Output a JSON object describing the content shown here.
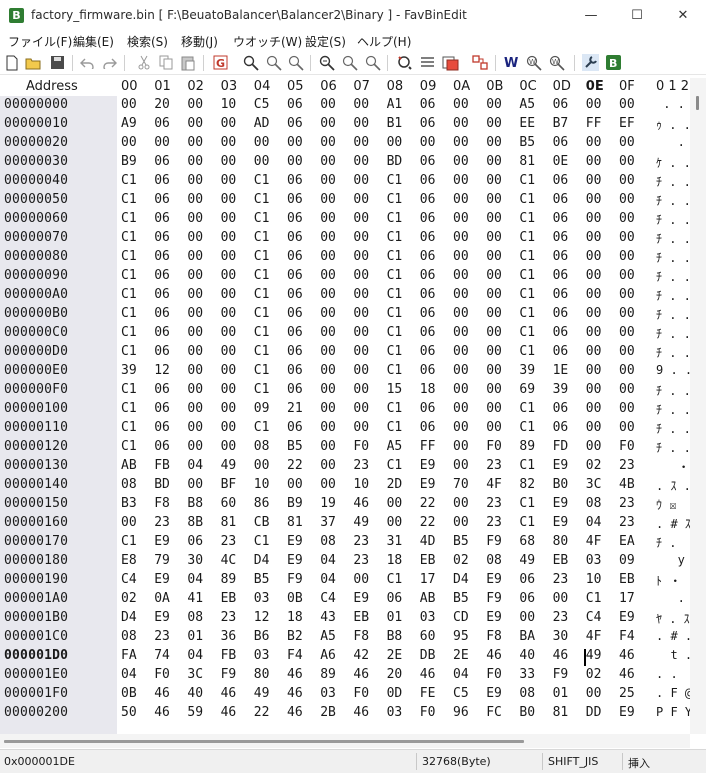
{
  "window": {
    "title": "factory_firmware.bin [ F:\\BeuatoBalancer\\Balancer2\\Binary ] - FavBinEdit",
    "app_icon_letter": "B",
    "minimize": "—",
    "maximize": "☐",
    "close": "✕"
  },
  "menu": [
    "ファイル(F)",
    "編集(E)",
    "検索(S)",
    "移動(J)",
    "ウオッチ(W)",
    "設定(S)",
    "ヘルプ(H)"
  ],
  "toolbar": {
    "icons": [
      "new-file-icon",
      "open-folder-icon",
      "save-icon",
      "undo-icon",
      "redo-icon",
      "cut-icon",
      "copy-icon",
      "paste-icon",
      "goto-icon",
      "search-icon",
      "search-next-icon",
      "search-prev-icon",
      "find-all-icon",
      "find-next-icon",
      "find-prev-icon",
      "compare-icon",
      "list-icon",
      "bookmark-icon",
      "jump-icon",
      "watch-icon",
      "watch-search-icon",
      "watch-settings-icon",
      "settings-wrench-icon",
      "about-icon"
    ]
  },
  "hex": {
    "address_header": "Address",
    "column_headers": [
      "00",
      "01",
      "02",
      "03",
      "04",
      "05",
      "06",
      "07",
      "08",
      "09",
      "0A",
      "0B",
      "0C",
      "0D",
      "0E",
      "0F"
    ],
    "active_column": "0E",
    "text_header": "0 1 2",
    "active_address": "000001D0",
    "rows": [
      {
        "addr": "00000000",
        "bytes": [
          "00",
          "20",
          "00",
          "10",
          "C5",
          "06",
          "00",
          "00",
          "A1",
          "06",
          "00",
          "00",
          "A5",
          "06",
          "00",
          "00"
        ],
        "text": " . ."
      },
      {
        "addr": "00000010",
        "bytes": [
          "A9",
          "06",
          "00",
          "00",
          "AD",
          "06",
          "00",
          "00",
          "B1",
          "06",
          "00",
          "00",
          "EE",
          "B7",
          "FF",
          "EF"
        ],
        "text": "ｩ . ."
      },
      {
        "addr": "00000020",
        "bytes": [
          "00",
          "00",
          "00",
          "00",
          "00",
          "00",
          "00",
          "00",
          "00",
          "00",
          "00",
          "00",
          "B5",
          "06",
          "00",
          "00"
        ],
        "text": "   . ."
      },
      {
        "addr": "00000030",
        "bytes": [
          "B9",
          "06",
          "00",
          "00",
          "00",
          "00",
          "00",
          "00",
          "BD",
          "06",
          "00",
          "00",
          "81",
          "0E",
          "00",
          "00"
        ],
        "text": "ｹ . ."
      },
      {
        "addr": "00000040",
        "bytes": [
          "C1",
          "06",
          "00",
          "00",
          "C1",
          "06",
          "00",
          "00",
          "C1",
          "06",
          "00",
          "00",
          "C1",
          "06",
          "00",
          "00"
        ],
        "text": "ﾁ . ."
      },
      {
        "addr": "00000050",
        "bytes": [
          "C1",
          "06",
          "00",
          "00",
          "C1",
          "06",
          "00",
          "00",
          "C1",
          "06",
          "00",
          "00",
          "C1",
          "06",
          "00",
          "00"
        ],
        "text": "ﾁ . ."
      },
      {
        "addr": "00000060",
        "bytes": [
          "C1",
          "06",
          "00",
          "00",
          "C1",
          "06",
          "00",
          "00",
          "C1",
          "06",
          "00",
          "00",
          "C1",
          "06",
          "00",
          "00"
        ],
        "text": "ﾁ . ."
      },
      {
        "addr": "00000070",
        "bytes": [
          "C1",
          "06",
          "00",
          "00",
          "C1",
          "06",
          "00",
          "00",
          "C1",
          "06",
          "00",
          "00",
          "C1",
          "06",
          "00",
          "00"
        ],
        "text": "ﾁ . ."
      },
      {
        "addr": "00000080",
        "bytes": [
          "C1",
          "06",
          "00",
          "00",
          "C1",
          "06",
          "00",
          "00",
          "C1",
          "06",
          "00",
          "00",
          "C1",
          "06",
          "00",
          "00"
        ],
        "text": "ﾁ . ."
      },
      {
        "addr": "00000090",
        "bytes": [
          "C1",
          "06",
          "00",
          "00",
          "C1",
          "06",
          "00",
          "00",
          "C1",
          "06",
          "00",
          "00",
          "C1",
          "06",
          "00",
          "00"
        ],
        "text": "ﾁ . ."
      },
      {
        "addr": "000000A0",
        "bytes": [
          "C1",
          "06",
          "00",
          "00",
          "C1",
          "06",
          "00",
          "00",
          "C1",
          "06",
          "00",
          "00",
          "C1",
          "06",
          "00",
          "00"
        ],
        "text": "ﾁ . ."
      },
      {
        "addr": "000000B0",
        "bytes": [
          "C1",
          "06",
          "00",
          "00",
          "C1",
          "06",
          "00",
          "00",
          "C1",
          "06",
          "00",
          "00",
          "C1",
          "06",
          "00",
          "00"
        ],
        "text": "ﾁ . ."
      },
      {
        "addr": "000000C0",
        "bytes": [
          "C1",
          "06",
          "00",
          "00",
          "C1",
          "06",
          "00",
          "00",
          "C1",
          "06",
          "00",
          "00",
          "C1",
          "06",
          "00",
          "00"
        ],
        "text": "ﾁ . ."
      },
      {
        "addr": "000000D0",
        "bytes": [
          "C1",
          "06",
          "00",
          "00",
          "C1",
          "06",
          "00",
          "00",
          "C1",
          "06",
          "00",
          "00",
          "C1",
          "06",
          "00",
          "00"
        ],
        "text": "ﾁ . ."
      },
      {
        "addr": "000000E0",
        "bytes": [
          "39",
          "12",
          "00",
          "00",
          "C1",
          "06",
          "00",
          "00",
          "C1",
          "06",
          "00",
          "00",
          "39",
          "1E",
          "00",
          "00"
        ],
        "text": "9 . ."
      },
      {
        "addr": "000000F0",
        "bytes": [
          "C1",
          "06",
          "00",
          "00",
          "C1",
          "06",
          "00",
          "00",
          "15",
          "18",
          "00",
          "00",
          "69",
          "39",
          "00",
          "00"
        ],
        "text": "ﾁ . ."
      },
      {
        "addr": "00000100",
        "bytes": [
          "C1",
          "06",
          "00",
          "00",
          "09",
          "21",
          "00",
          "00",
          "C1",
          "06",
          "00",
          "00",
          "C1",
          "06",
          "00",
          "00"
        ],
        "text": "ﾁ . ."
      },
      {
        "addr": "00000110",
        "bytes": [
          "C1",
          "06",
          "00",
          "00",
          "C1",
          "06",
          "00",
          "00",
          "C1",
          "06",
          "00",
          "00",
          "C1",
          "06",
          "00",
          "00"
        ],
        "text": "ﾁ . ."
      },
      {
        "addr": "00000120",
        "bytes": [
          "C1",
          "06",
          "00",
          "00",
          "08",
          "B5",
          "00",
          "F0",
          "A5",
          "FF",
          "00",
          "F0",
          "89",
          "FD",
          "00",
          "F0"
        ],
        "text": "ﾁ . ."
      },
      {
        "addr": "00000130",
        "bytes": [
          "AB",
          "FB",
          "04",
          "49",
          "00",
          "22",
          "00",
          "23",
          "C1",
          "E9",
          "00",
          "23",
          "C1",
          "E9",
          "02",
          "23"
        ],
        "text": "   ・"
      },
      {
        "addr": "00000140",
        "bytes": [
          "08",
          "BD",
          "00",
          "BF",
          "10",
          "00",
          "00",
          "10",
          "2D",
          "E9",
          "70",
          "4F",
          "82",
          "B0",
          "3C",
          "4B"
        ],
        "text": ". ｽ ."
      },
      {
        "addr": "00000150",
        "bytes": [
          "B3",
          "F8",
          "B8",
          "60",
          "86",
          "B9",
          "19",
          "46",
          "00",
          "22",
          "00",
          "23",
          "C1",
          "E9",
          "08",
          "23"
        ],
        "text": "ｳ ☒"
      },
      {
        "addr": "00000160",
        "bytes": [
          "00",
          "23",
          "8B",
          "81",
          "CB",
          "81",
          "37",
          "49",
          "00",
          "22",
          "00",
          "23",
          "C1",
          "E9",
          "04",
          "23"
        ],
        "text": ". # ｽ"
      },
      {
        "addr": "00000170",
        "bytes": [
          "C1",
          "E9",
          "06",
          "23",
          "C1",
          "E9",
          "08",
          "23",
          "31",
          "4D",
          "B5",
          "F9",
          "68",
          "80",
          "4F",
          "EA"
        ],
        "text": "ﾁ ."
      },
      {
        "addr": "00000180",
        "bytes": [
          "E8",
          "79",
          "30",
          "4C",
          "D4",
          "E9",
          "04",
          "23",
          "18",
          "EB",
          "02",
          "08",
          "49",
          "EB",
          "03",
          "09"
        ],
        "text": "   y 0"
      },
      {
        "addr": "00000190",
        "bytes": [
          "C4",
          "E9",
          "04",
          "89",
          "B5",
          "F9",
          "04",
          "00",
          "C1",
          "17",
          "D4",
          "E9",
          "06",
          "23",
          "10",
          "EB"
        ],
        "text": "ﾄ ・"
      },
      {
        "addr": "000001A0",
        "bytes": [
          "02",
          "0A",
          "41",
          "EB",
          "03",
          "0B",
          "C4",
          "E9",
          "06",
          "AB",
          "B5",
          "F9",
          "06",
          "00",
          "C1",
          "17"
        ],
        "text": "   . A"
      },
      {
        "addr": "000001B0",
        "bytes": [
          "D4",
          "E9",
          "08",
          "23",
          "12",
          "18",
          "43",
          "EB",
          "01",
          "03",
          "CD",
          "E9",
          "00",
          "23",
          "C4",
          "E9"
        ],
        "text": "ﾔ . ｽ"
      },
      {
        "addr": "000001C0",
        "bytes": [
          "08",
          "23",
          "01",
          "36",
          "B6",
          "B2",
          "A5",
          "F8",
          "B8",
          "60",
          "95",
          "F8",
          "BA",
          "30",
          "4F",
          "F4"
        ],
        "text": ". # ."
      },
      {
        "addr": "000001D0",
        "bytes": [
          "FA",
          "74",
          "04",
          "FB",
          "03",
          "F4",
          "A6",
          "42",
          "2E",
          "DB",
          "2E",
          "46",
          "40",
          "46",
          "49",
          "46"
        ],
        "text": "  t ."
      },
      {
        "addr": "000001E0",
        "bytes": [
          "04",
          "F0",
          "3C",
          "F9",
          "80",
          "46",
          "89",
          "46",
          "20",
          "46",
          "04",
          "F0",
          "33",
          "F9",
          "02",
          "46"
        ],
        "text": ". ."
      },
      {
        "addr": "000001F0",
        "bytes": [
          "0B",
          "46",
          "40",
          "46",
          "49",
          "46",
          "03",
          "F0",
          "0D",
          "FE",
          "C5",
          "E9",
          "08",
          "01",
          "00",
          "25"
        ],
        "text": ". F @"
      },
      {
        "addr": "00000200",
        "bytes": [
          "50",
          "46",
          "59",
          "46",
          "22",
          "46",
          "2B",
          "46",
          "03",
          "F0",
          "96",
          "FC",
          "B0",
          "81",
          "DD",
          "E9"
        ],
        "text": "P F Y"
      }
    ]
  },
  "status": {
    "address": "0x000001DE",
    "size": "32768(Byte)",
    "encoding": "SHIFT_JIS",
    "mode": "挿入"
  }
}
